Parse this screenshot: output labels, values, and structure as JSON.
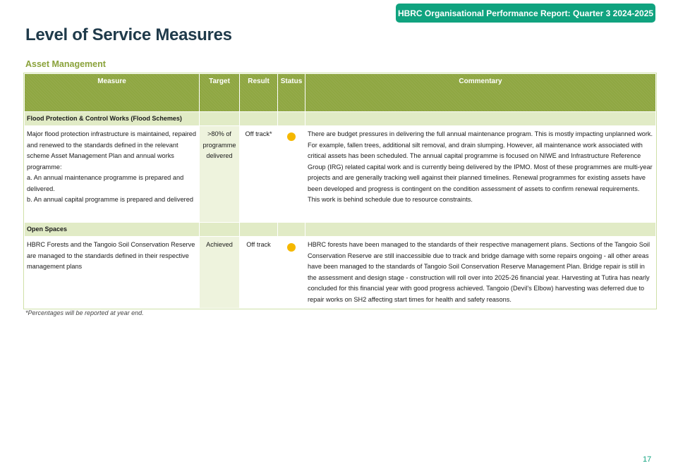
{
  "header": {
    "report_title": "HBRC Organisational Performance Report: Quarter 3 2024-2025"
  },
  "page": {
    "title": "Level of Service Measures",
    "section": "Asset Management",
    "footnote": "*Percentages will be reported at year end.",
    "page_number": "17"
  },
  "table": {
    "columns": {
      "measure": "Measure",
      "target": "Target",
      "result": "Result",
      "status": "Status",
      "commentary": "Commentary"
    },
    "groups": [
      {
        "label": "Flood Protection & Control Works (Flood Schemes)",
        "rows": [
          {
            "measure_lines": [
              "Major flood protection infrastructure is maintained, repaired and renewed to the standards defined in the relevant scheme Asset Management Plan and annual works programme:",
              "a. An annual maintenance programme is prepared and delivered.",
              "b. An annual capital programme is prepared and delivered"
            ],
            "target": ">80% of programme delivered",
            "result": "Off track*",
            "status": "amber",
            "commentary": "There are budget pressures in delivering the full annual maintenance program. This is mostly impacting unplanned work. For example, fallen trees, additional silt removal, and drain slumping. However, all maintenance work associated with critical assets has been scheduled.  The annual capital programme is focused on NIWE and Infrastructure Reference Group (IRG) related capital work and is currently being delivered by the IPMO. Most of these programmes are multi-year projects and are generally tracking well against their planned timelines. Renewal programmes for existing assets have been developed and progress is contingent on the condition assessment of assets to confirm renewal requirements. This work is behind schedule due to resource constraints."
          }
        ]
      },
      {
        "label": "Open Spaces",
        "rows": [
          {
            "measure_lines": [
              "HBRC Forests and the Tangoio Soil Conservation Reserve are managed to the standards defined in their respective management plans"
            ],
            "target": "Achieved",
            "result": "Off track",
            "status": "amber",
            "commentary": "HBRC forests have been managed to the standards of their respective management plans. Sections of the Tangoio Soil Conservation Reserve are still inaccessible due to track and bridge damage with some repairs ongoing - all other areas have been managed to the standards of Tangoio Soil Conservation Reserve Management Plan. Bridge repair is still in the assessment and design stage - construction will roll over into 2025-26 financial year. Harvesting at Tutira has nearly concluded for this financial year with good progress achieved. Tangoio (Devil’s Elbow) harvesting was deferred due to repair works on SH2 affecting start times for health and safety reasons."
          }
        ]
      }
    ]
  },
  "colors": {
    "brand_green": "#10a37f",
    "header_olive": "#8fa742",
    "group_band": "#e1ebc6",
    "target_shade": "#eef3dd",
    "status_amber": "#f5b800",
    "title_navy": "#1f3a4a"
  }
}
